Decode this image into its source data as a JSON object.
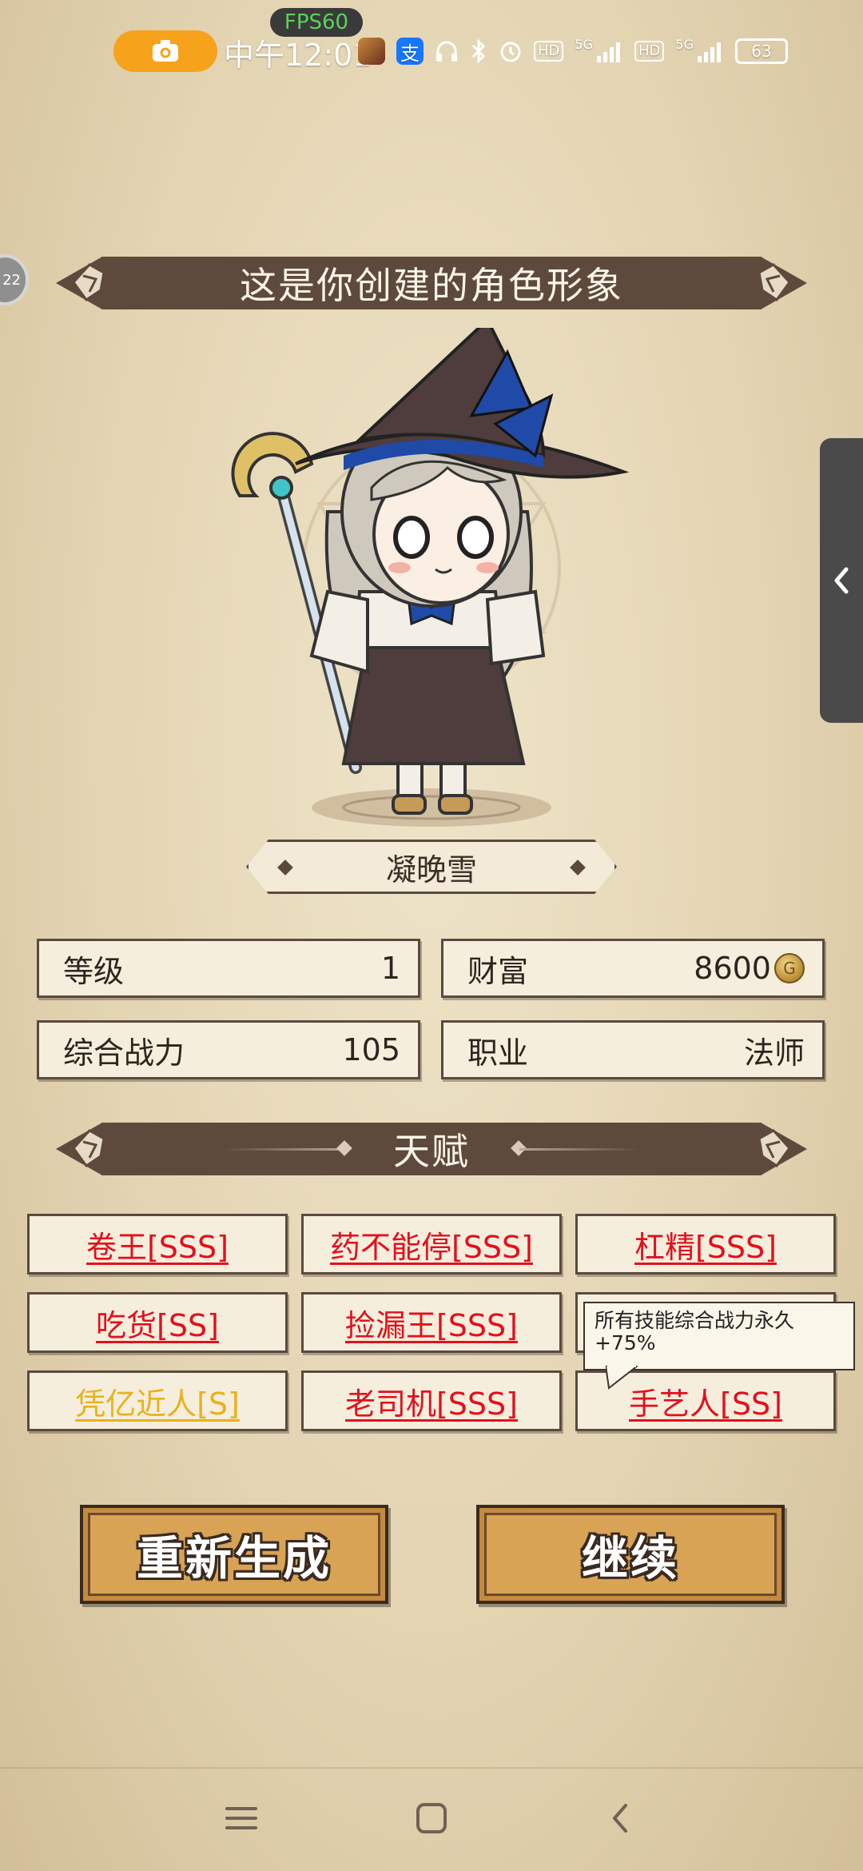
{
  "status_bar": {
    "fps": "FPS60",
    "time": "中午12:01",
    "battery": "63",
    "network_label_1": "5G",
    "network_label_2": "5G",
    "hd_label": "HD",
    "app_alipay_glyph": "支"
  },
  "edge_circle": {
    "label": "22"
  },
  "header": {
    "title": "这是你创建的角色形象"
  },
  "character": {
    "name": "凝晚雪"
  },
  "stats": [
    {
      "label": "等级",
      "value": "1"
    },
    {
      "label": "财富",
      "value": "8600"
    },
    {
      "label": "综合战力",
      "value": "105"
    },
    {
      "label": "职业",
      "value": "法师"
    }
  ],
  "talent_section": {
    "title": "天赋"
  },
  "talents": [
    {
      "label": "卷王[SSS]",
      "color": "#e3101d"
    },
    {
      "label": "药不能停[SSS]",
      "color": "#e3101d"
    },
    {
      "label": "杠精[SSS]",
      "color": "#e3101d"
    },
    {
      "label": "吃货[SS]",
      "color": "#e3101d"
    },
    {
      "label": "捡漏王[SSS]",
      "color": "#e3101d"
    },
    {
      "label": "",
      "color": "#e3101d"
    },
    {
      "label": "凭亿近人[S]",
      "color": "#e8b21c"
    },
    {
      "label": "老司机[SSS]",
      "color": "#e3101d"
    },
    {
      "label": "手艺人[SS]",
      "color": "#e3101d"
    }
  ],
  "tooltip": {
    "text": "所有技能综合战力永久+75%"
  },
  "buttons": {
    "regenerate": "重新生成",
    "continue": "继续"
  },
  "colors": {
    "banner": "#5e4a3d",
    "button": "#d8a354",
    "talent_red": "#e3101d",
    "talent_gold": "#e8b21c"
  }
}
